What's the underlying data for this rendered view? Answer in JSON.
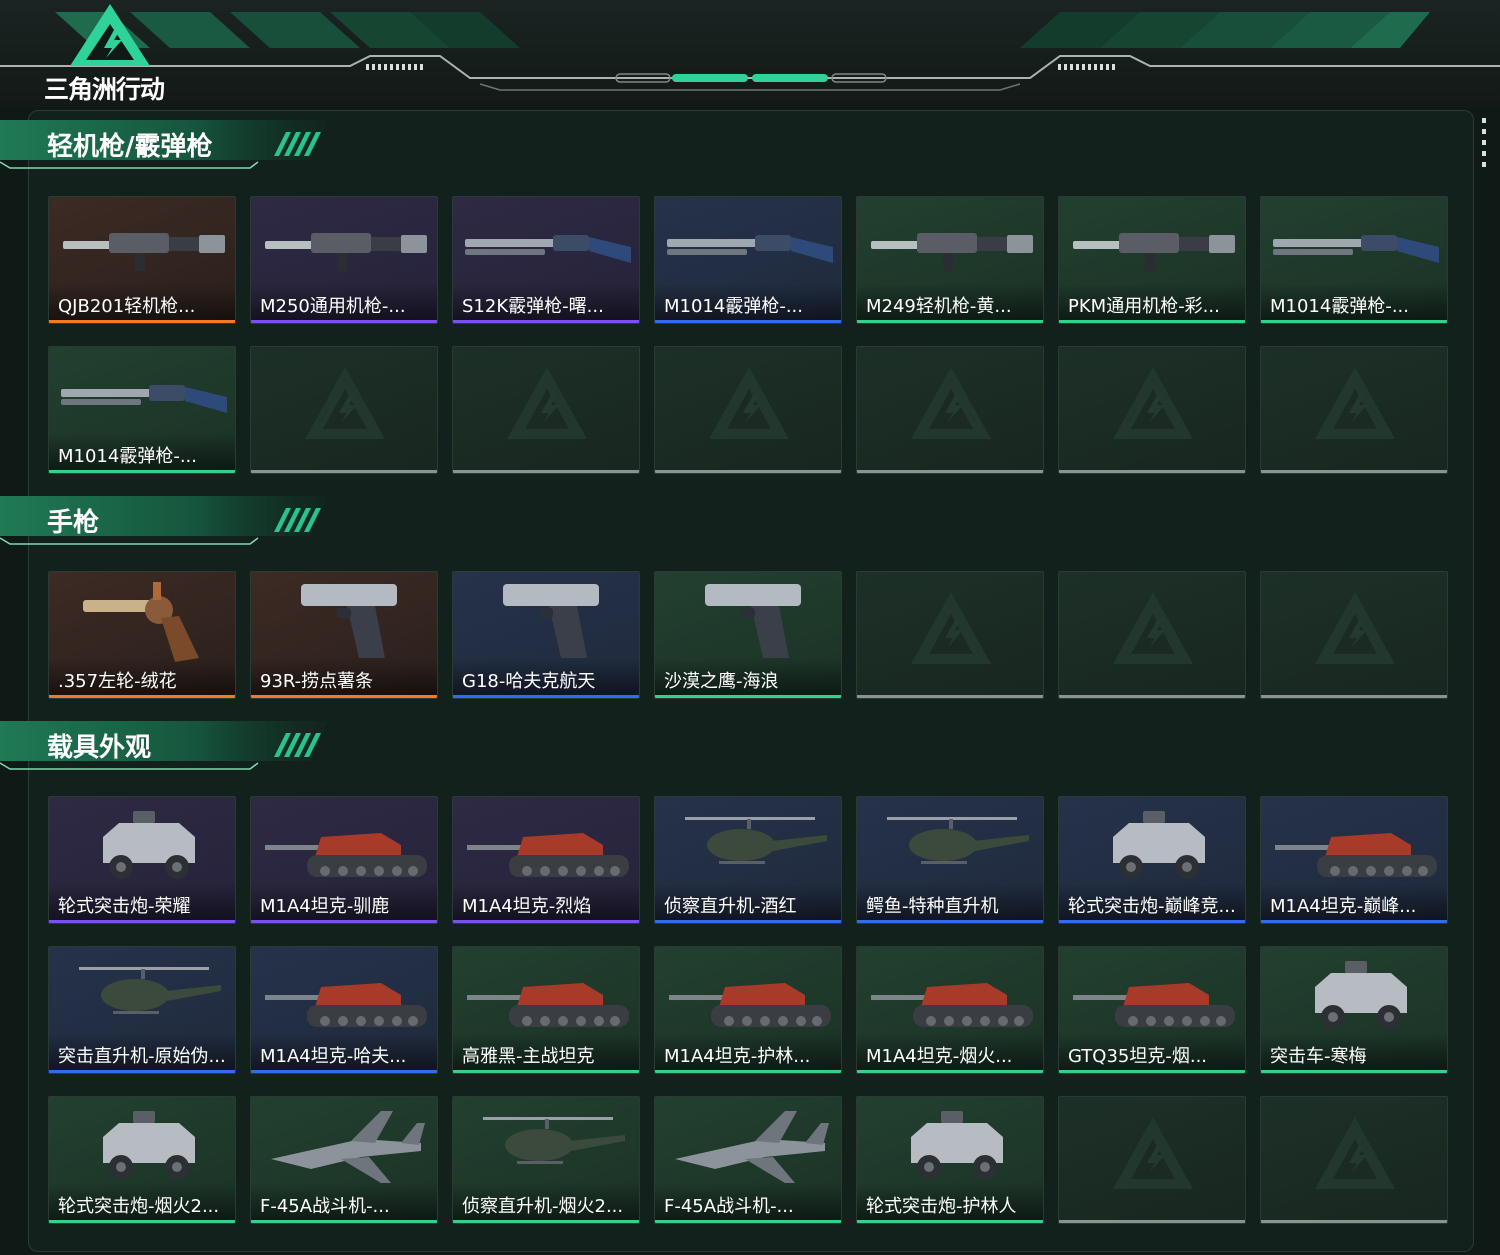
{
  "app": {
    "logo_text": "三角洲行动"
  },
  "colors": {
    "orange": "#f07a2a",
    "purple": "#7a4ff0",
    "blue": "#2f6cf0",
    "green": "#36d08c",
    "empty": "#8a9390",
    "accent": "#2fd39a"
  },
  "sections": [
    {
      "title": "轻机枪/霰弹枪",
      "items": [
        {
          "name": "QJB201轻机枪...",
          "rarity": "orange",
          "icon": "machine-gun-icon"
        },
        {
          "name": "M250通用机枪-...",
          "rarity": "purple",
          "icon": "machine-gun-icon"
        },
        {
          "name": "S12K霰弹枪-曙...",
          "rarity": "purple",
          "icon": "shotgun-icon"
        },
        {
          "name": "M1014霰弹枪-...",
          "rarity": "blue",
          "icon": "shotgun-icon"
        },
        {
          "name": "M249轻机枪-黄...",
          "rarity": "green",
          "icon": "machine-gun-icon"
        },
        {
          "name": "PKM通用机枪-彩...",
          "rarity": "green",
          "icon": "machine-gun-icon"
        },
        {
          "name": "M1014霰弹枪-...",
          "rarity": "green",
          "icon": "shotgun-icon"
        },
        {
          "name": "M1014霰弹枪-...",
          "rarity": "green",
          "icon": "shotgun-icon"
        },
        {
          "name": "",
          "rarity": "empty"
        },
        {
          "name": "",
          "rarity": "empty"
        },
        {
          "name": "",
          "rarity": "empty"
        },
        {
          "name": "",
          "rarity": "empty"
        },
        {
          "name": "",
          "rarity": "empty"
        },
        {
          "name": "",
          "rarity": "empty"
        }
      ]
    },
    {
      "title": "手枪",
      "items": [
        {
          "name": ".357左轮-绒花",
          "rarity": "orange",
          "icon": "revolver-icon"
        },
        {
          "name": "93R-捞点薯条",
          "rarity": "orange",
          "icon": "pistol-icon"
        },
        {
          "name": "G18-哈夫克航天",
          "rarity": "blue",
          "icon": "pistol-icon"
        },
        {
          "name": "沙漠之鹰-海浪",
          "rarity": "green",
          "icon": "pistol-icon"
        },
        {
          "name": "",
          "rarity": "empty"
        },
        {
          "name": "",
          "rarity": "empty"
        },
        {
          "name": "",
          "rarity": "empty"
        }
      ]
    },
    {
      "title": "载具外观",
      "items": [
        {
          "name": "轮式突击炮-荣耀",
          "rarity": "purple",
          "icon": "armored-car-icon"
        },
        {
          "name": "M1A4坦克-驯鹿",
          "rarity": "purple",
          "icon": "tank-icon"
        },
        {
          "name": "M1A4坦克-烈焰",
          "rarity": "purple",
          "icon": "tank-icon"
        },
        {
          "name": "侦察直升机-酒红",
          "rarity": "blue",
          "icon": "helicopter-icon"
        },
        {
          "name": "鳄鱼-特种直升机",
          "rarity": "blue",
          "icon": "helicopter-icon"
        },
        {
          "name": "轮式突击炮-巅峰竞...",
          "rarity": "blue",
          "icon": "armored-car-icon"
        },
        {
          "name": "M1A4坦克-巅峰...",
          "rarity": "blue",
          "icon": "tank-icon"
        },
        {
          "name": "突击直升机-原始伪...",
          "rarity": "blue",
          "icon": "helicopter-icon"
        },
        {
          "name": "M1A4坦克-哈夫...",
          "rarity": "blue",
          "icon": "tank-icon"
        },
        {
          "name": "高雅黑-主战坦克",
          "rarity": "green",
          "icon": "tank-icon"
        },
        {
          "name": "M1A4坦克-护林...",
          "rarity": "green",
          "icon": "tank-icon"
        },
        {
          "name": "M1A4坦克-烟火...",
          "rarity": "green",
          "icon": "tank-icon"
        },
        {
          "name": "GTQ35坦克-烟...",
          "rarity": "green",
          "icon": "tank-icon"
        },
        {
          "name": "突击车-寒梅",
          "rarity": "green",
          "icon": "armored-car-icon"
        },
        {
          "name": "轮式突击炮-烟火2...",
          "rarity": "green",
          "icon": "armored-car-icon"
        },
        {
          "name": "F-45A战斗机-...",
          "rarity": "green",
          "icon": "jet-icon"
        },
        {
          "name": "侦察直升机-烟火2...",
          "rarity": "green",
          "icon": "helicopter-icon"
        },
        {
          "name": "F-45A战斗机-...",
          "rarity": "green",
          "icon": "jet-icon"
        },
        {
          "name": "轮式突击炮-护林人",
          "rarity": "green",
          "icon": "armored-car-icon"
        },
        {
          "name": "",
          "rarity": "empty"
        },
        {
          "name": "",
          "rarity": "empty"
        }
      ]
    }
  ]
}
